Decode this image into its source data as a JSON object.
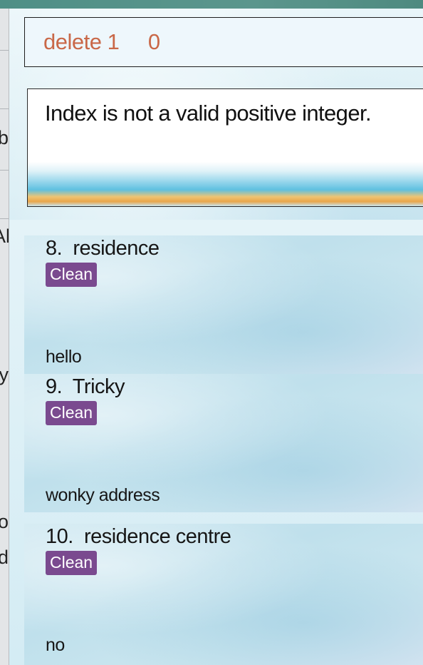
{
  "command": {
    "text": "delete 1     0"
  },
  "result": {
    "message": "Index is not a valid positive integer."
  },
  "left_panel": {
    "clipped_chars": [
      "b",
      "Al",
      "y",
      "o",
      "d"
    ]
  },
  "list": {
    "items": [
      {
        "index": "8.",
        "name": "residence",
        "tag": "Clean",
        "address": "hello"
      },
      {
        "index": "9.",
        "name": "Tricky",
        "tag": "Clean",
        "address": "wonky address"
      },
      {
        "index": "10.",
        "name": "residence centre",
        "tag": "Clean",
        "address": "no"
      }
    ]
  },
  "colors": {
    "command_text": "#c96848",
    "tag_bg": "#7a4a8f",
    "top_strip": "#5b968d"
  }
}
